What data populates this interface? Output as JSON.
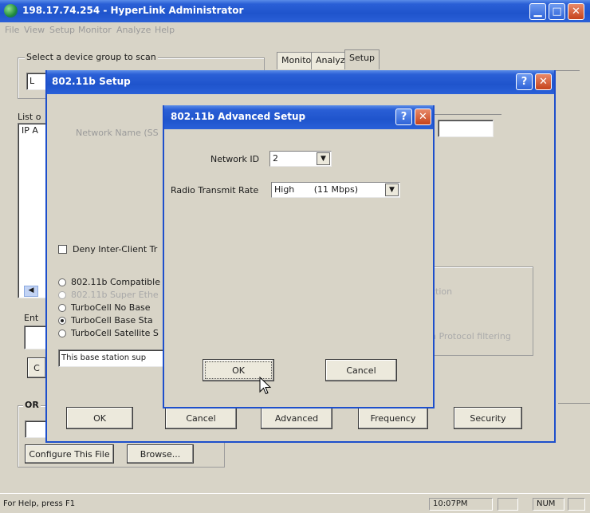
{
  "main": {
    "title": "198.17.74.254 - HyperLink Administrator",
    "menu": [
      "File",
      "View",
      "Setup",
      "Monitor",
      "Analyze",
      "Help"
    ],
    "device_group_label": "Select a device group to scan",
    "device_group_value": "L",
    "list_label": "List o",
    "list_header": "IP A",
    "tabs": [
      "Monitor",
      "Analyze",
      "Setup"
    ],
    "entry_label": "Ent",
    "c_label": "C",
    "or_label": "OR",
    "configure_button": "Configure This File",
    "browse_button": "Browse...",
    "statusbar": {
      "help": "For Help, press F1",
      "time": "10:07PM",
      "num": "NUM"
    }
  },
  "setup": {
    "title": "802.11b Setup",
    "network_name_label": "Network Name (SS",
    "deny_checkbox": "Deny Inter-Client Tr",
    "radios": [
      {
        "label": "802.11b Compatible",
        "checked": false,
        "disabled": false
      },
      {
        "label": "802.11b Super Ethe",
        "checked": false,
        "disabled": true
      },
      {
        "label": "TurboCell No Base",
        "checked": false,
        "disabled": false
      },
      {
        "label": "TurboCell Base Sta",
        "checked": true,
        "disabled": false
      },
      {
        "label": "TurboCell Satellite S",
        "checked": false,
        "disabled": false
      }
    ],
    "base_station_note": "This base station sup",
    "right_group": {
      "line1": "ction",
      "line2": "h Protocol filtering"
    },
    "buttons": {
      "ok": "OK",
      "cancel": "Cancel",
      "advanced": "Advanced",
      "frequency": "Frequency",
      "security": "Security"
    }
  },
  "advanced": {
    "title": "802.11b Advanced Setup",
    "network_id_label": "Network ID",
    "network_id_value": "2",
    "rate_label": "Radio Transmit Rate",
    "rate_value": "High       (11 Mbps)",
    "ok": "OK",
    "cancel": "Cancel"
  },
  "icons": {
    "help": "?",
    "close": "✕",
    "minimize": "▁",
    "maximize": "□",
    "dropdown": "▼"
  }
}
